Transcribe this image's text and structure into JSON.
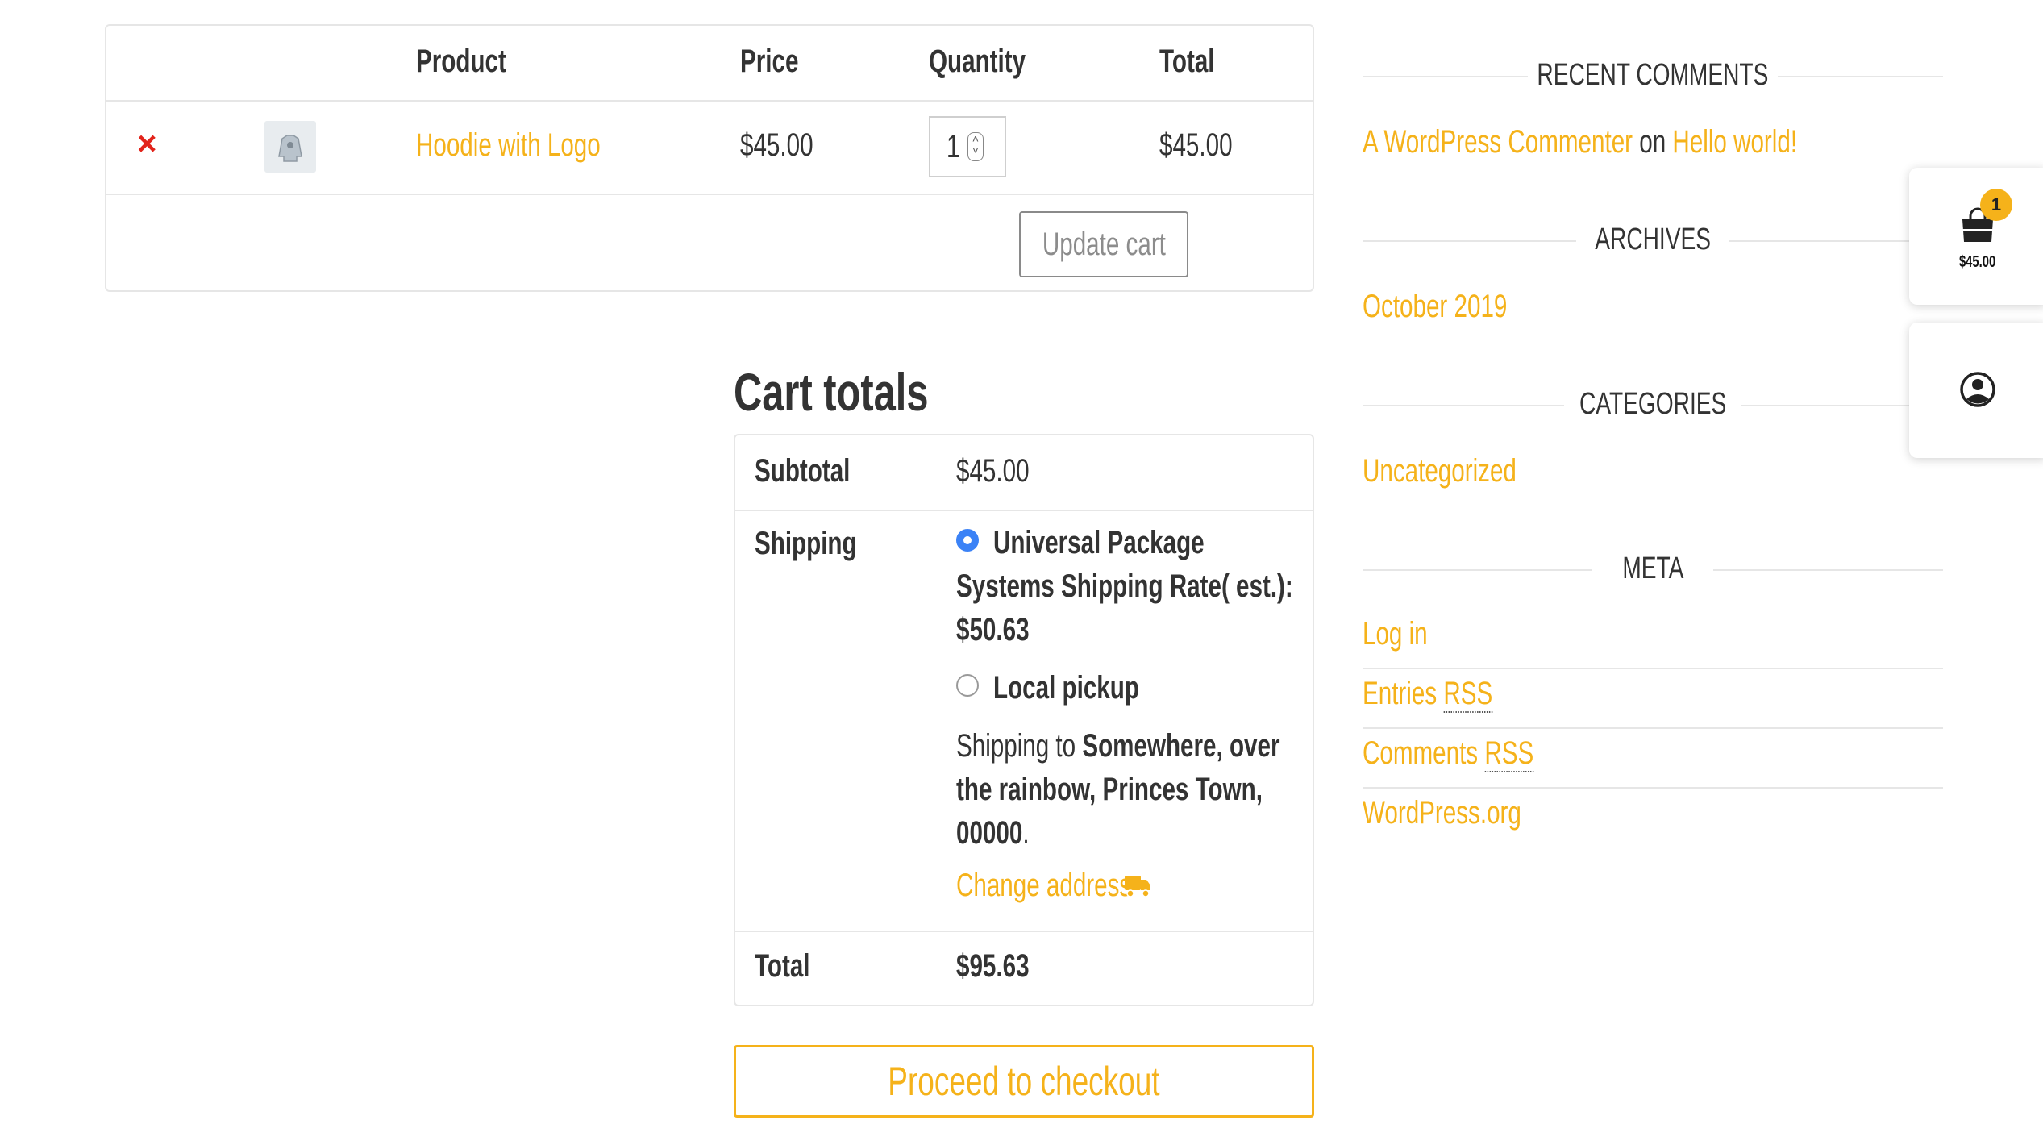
{
  "cart_table": {
    "headers": {
      "product": "Product",
      "price": "Price",
      "quantity": "Quantity",
      "total": "Total"
    },
    "row": {
      "remove": "×",
      "product": "Hoodie with Logo",
      "price": "$45.00",
      "quantity": "1",
      "total": "$45.00"
    },
    "update_label": "Update cart"
  },
  "cart_totals": {
    "title": "Cart totals",
    "subtotal_label": "Subtotal",
    "subtotal_value": "$45.00",
    "shipping_label": "Shipping",
    "option_1_line1": "Universal Package",
    "option_1_line2": "Systems Shipping Rate( est.):",
    "option_1_line3": "$50.63",
    "option_2": "Local pickup",
    "shipping_to_prefix": "Shipping to",
    "shipping_to_line1": "Somewhere, over",
    "shipping_to_line2": "the rainbow, Princes Town,",
    "shipping_to_line3": "00000",
    "shipping_to_suffix": ".",
    "change_address": "Change address",
    "total_label": "Total",
    "total_value": "$95.63",
    "checkout_label": "Proceed to checkout"
  },
  "sidebar": {
    "recent_comments_title": "RECENT COMMENTS",
    "comment_author": "A WordPress Commenter",
    "comment_on": "on",
    "comment_post": "Hello world!",
    "archives_title": "ARCHIVES",
    "archive_item": "October 2019",
    "categories_title": "CATEGORIES",
    "category_item": "Uncategorized",
    "meta_title": "META",
    "meta_login": "Log in",
    "meta_entries": "Entries",
    "meta_comments": "Comments",
    "meta_rss": "RSS",
    "meta_wordpress": "WordPress.org"
  },
  "floating_cart": {
    "count": "1",
    "amount": "$45.00"
  },
  "colors": {
    "accent": "#f5b21a",
    "remove": "#e2231a",
    "radio": "#3b82f6",
    "text": "#333333",
    "border": "#e6e6e6"
  },
  "icons": {
    "remove": "close-icon",
    "shipping": "truck-icon",
    "cart": "shopping-bag-icon",
    "account": "user-circle-icon"
  }
}
